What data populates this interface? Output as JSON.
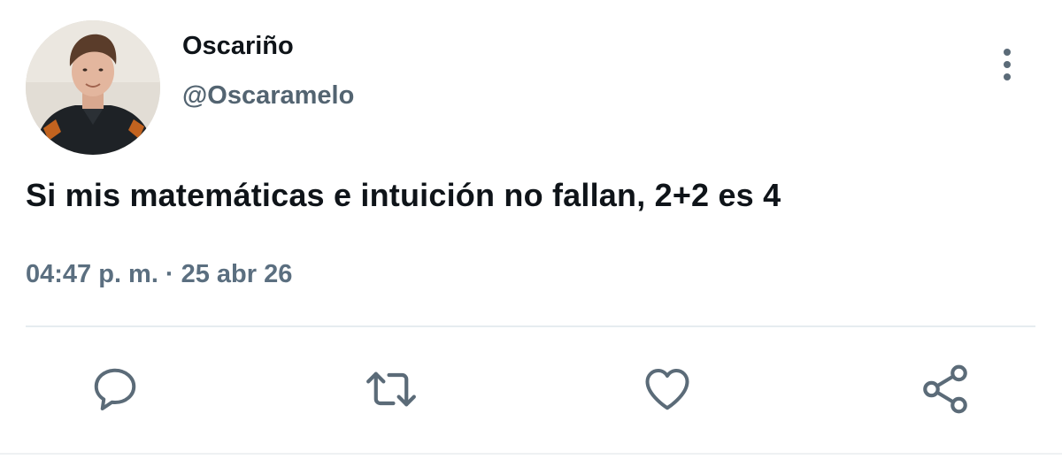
{
  "tweet": {
    "display_name": "Oscariño",
    "handle": "@Oscaramelo",
    "text": "Si mis matemáticas e intuición no fallan, 2+2 es 4",
    "time": "04:47 p. m.",
    "separator": "·",
    "date": "25 abr 26"
  },
  "actions": [
    {
      "name": "reply",
      "icon": "reply-icon"
    },
    {
      "name": "retweet",
      "icon": "retweet-icon"
    },
    {
      "name": "like",
      "icon": "heart-icon"
    },
    {
      "name": "share",
      "icon": "share-icon"
    }
  ],
  "colors": {
    "text_primary": "#0f1419",
    "text_secondary": "#536471",
    "icon": "#5b6b78",
    "divider": "#e6ecf0"
  }
}
